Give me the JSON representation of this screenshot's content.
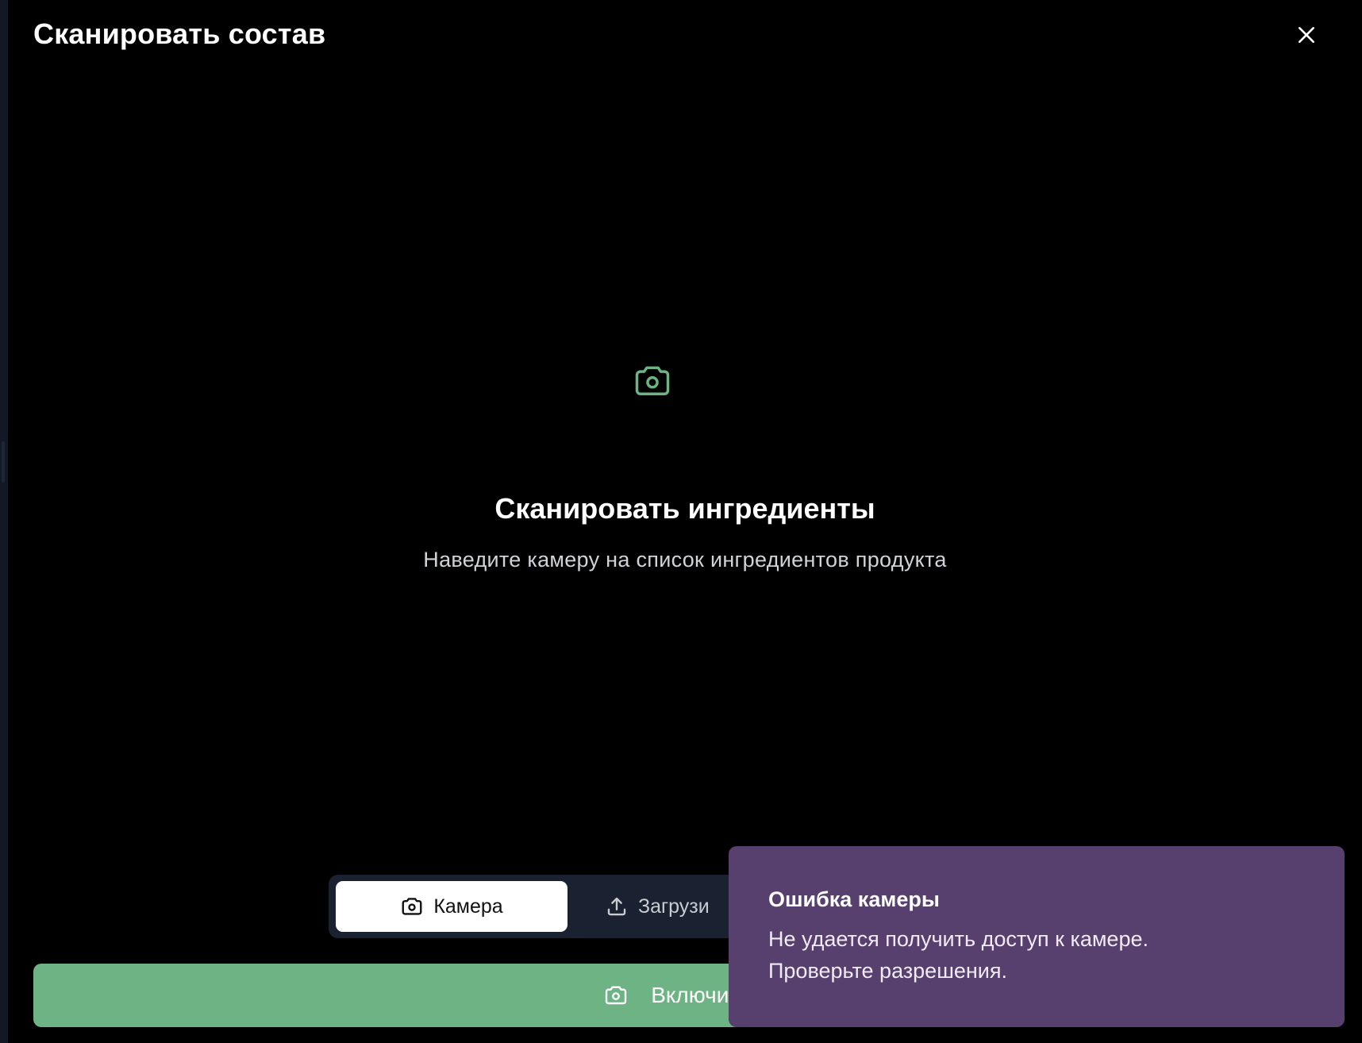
{
  "modal": {
    "title": "Сканировать состав",
    "close_icon": "close-icon"
  },
  "main": {
    "icon": "camera-icon",
    "accent_color": "#6db383",
    "heading": "Сканировать ингредиенты",
    "subtext": "Наведите камеру на список ингредиентов продукта"
  },
  "mode_tabs": [
    {
      "label": "Камера",
      "icon": "camera-icon",
      "selected": true
    },
    {
      "label": "Загрузи",
      "icon": "upload-icon",
      "selected": false
    }
  ],
  "action_button": {
    "label": "Включить",
    "icon": "camera-icon",
    "color": "#6db383"
  },
  "toast": {
    "title": "Ошибка камеры",
    "message": "Не удается получить доступ к камере. Проверьте разрешения.",
    "color": "#573f6e"
  }
}
